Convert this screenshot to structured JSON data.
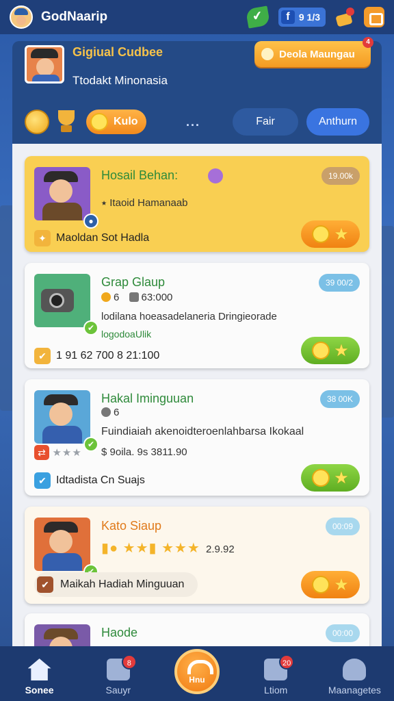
{
  "app": {
    "title": "GodNaarip"
  },
  "topbar": {
    "fb_value": "9 1/3"
  },
  "profile": {
    "title": "Gigiual Cudbee",
    "subtitle": "Ttodakt Minonasia",
    "badge_label": "Deola Maungau",
    "badge_count": "4"
  },
  "filters": {
    "orange_label": "Kulo",
    "more": "...",
    "tab_1": "Fair",
    "tab_2": "Anthurn"
  },
  "cards": [
    {
      "title": "Hosail Behan:",
      "tag": "19.00k",
      "line1": "⭑ Itaoid Hamanaab",
      "footer": "Maoldan Sot Hadla"
    },
    {
      "title": "Grap Glaup",
      "tag": "39 00/2",
      "line1_a": "6",
      "line1_b": "63:000",
      "line2": "lodilana hoeasadelaneria Dringieorade",
      "line3": "logodoaUlik",
      "footer": "1 91 62 700 8 21:100"
    },
    {
      "title": "Hakal Iminguuan",
      "tag": "38 00K",
      "line1": "6",
      "line2": "Fuindiaiah akenoidteroenlahbarsa Ikokaal",
      "line3": "$ 9oila. 9s 3811.90",
      "footer": "Idtadista Cn Suajs"
    },
    {
      "title": "Kato Siaup",
      "tag": "00:09",
      "rating": "2.9.92",
      "footer": "Maikah Hadiah Minguuan"
    },
    {
      "title": "Haode",
      "tag": "00:00"
    }
  ],
  "nav": {
    "home": "Sonee",
    "shop": "Sauyr",
    "shop_badge": "8",
    "center": "Hnu",
    "edit": "Ltiom",
    "edit_badge": "20",
    "managers": "Maanagetes"
  },
  "colors": {
    "accent_orange": "#f28a1c",
    "nav_bg": "#1d3a70",
    "gold_card": "#f9cf52",
    "green_action": "#6cc33a"
  }
}
